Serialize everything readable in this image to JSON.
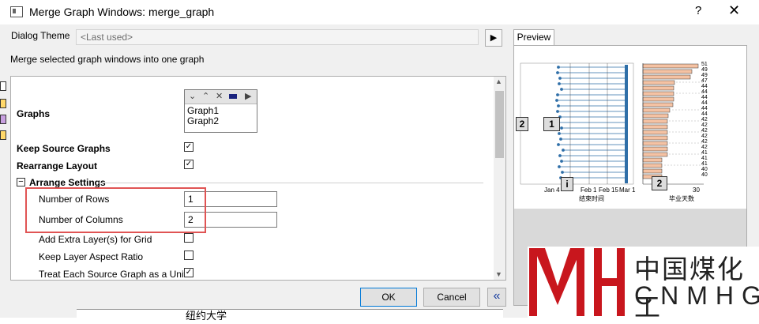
{
  "window": {
    "title": "Merge Graph Windows: merge_graph",
    "help": "?",
    "close": "✕"
  },
  "dialog_theme": {
    "label": "Dialog Theme",
    "value": "<Last used>",
    "arrow": "▶"
  },
  "description": "Merge selected graph windows into one graph",
  "graphs": {
    "label": "Graphs",
    "items": [
      "Graph1",
      "Graph2"
    ]
  },
  "options": {
    "keep_source": {
      "label": "Keep Source Graphs",
      "checked": true
    },
    "rearrange": {
      "label": "Rearrange Layout",
      "checked": true
    },
    "arrange_settings": {
      "label": "Arrange Settings",
      "toggle": "−"
    },
    "rows": {
      "label": "Number of Rows",
      "value": "1"
    },
    "cols": {
      "label": "Number of Columns",
      "value": "2"
    },
    "extra_layers": {
      "label": "Add Extra Layer(s) for Grid",
      "checked": false
    },
    "aspect_ratio": {
      "label": "Keep Layer Aspect Ratio",
      "checked": false
    },
    "treat_unit": {
      "label": "Treat Each Source Graph as a Unit",
      "checked": true
    }
  },
  "buttons": {
    "ok": "OK",
    "cancel": "Cancel",
    "collapse": "«"
  },
  "preview": {
    "tab": "Preview",
    "panel1_badge": "1",
    "panel2_badge": "2",
    "left_badge2": "2",
    "left_badge1": "1",
    "info_badge": "i",
    "x_ticks_left": [
      "Jan 4",
      "Feb 1",
      "Feb 15",
      "Mar 1"
    ],
    "xlabel_left": "结束时间",
    "x_ticks_right": [
      "30"
    ],
    "xlabel_right": "毕业天数",
    "bar_values": [
      "51",
      "49",
      "49",
      "47",
      "44",
      "44",
      "44",
      "44",
      "44",
      "44",
      "42",
      "42",
      "42",
      "42",
      "42",
      "42",
      "41",
      "41",
      "41",
      "40",
      "40"
    ]
  },
  "watermark": {
    "cn": "中国煤化工",
    "en": "CNMHG",
    "color": "#c8161d"
  },
  "background_text": "纽约大学"
}
